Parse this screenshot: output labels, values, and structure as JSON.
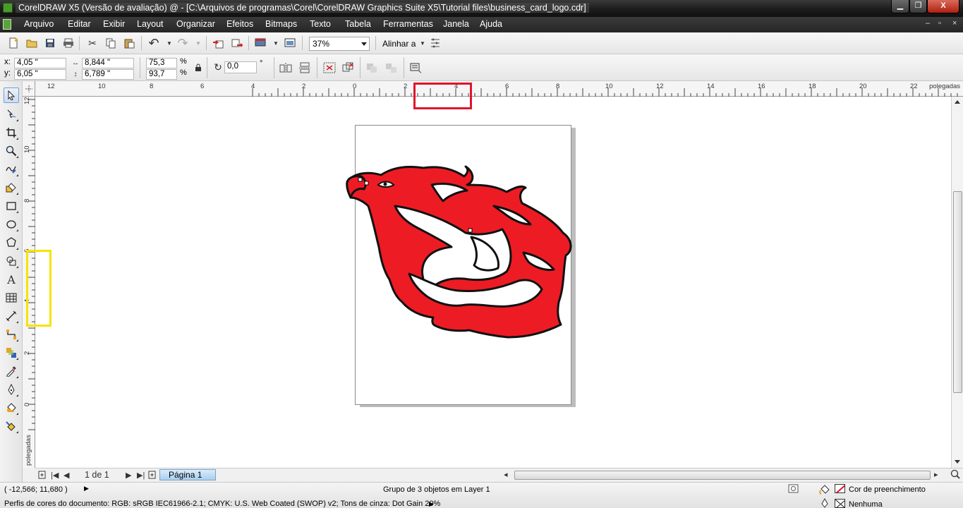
{
  "window": {
    "title": "CorelDRAW X5 (Versão de avaliação) @ - [C:\\Arquivos de programas\\Corel\\CorelDRAW Graphics Suite X5\\Tutorial files\\business_card_logo.cdr]",
    "minimize": "▁",
    "restore": "❐",
    "close": "X"
  },
  "menu": {
    "items": [
      "Arquivo",
      "Editar",
      "Exibir",
      "Layout",
      "Organizar",
      "Efeitos",
      "Bitmaps",
      "Texto",
      "Tabela",
      "Ferramentas",
      "Janela",
      "Ajuda"
    ],
    "mdi_controls": [
      "–",
      "▫",
      "×"
    ]
  },
  "toolbar": {
    "zoom": "37%",
    "align_label": "Alinhar a"
  },
  "property_bar": {
    "x_label": "x:",
    "x_value": "4,05 \"",
    "y_label": "y:",
    "y_value": "6,05 \"",
    "width_value": "8,844 \"",
    "height_value": "6,789 \"",
    "scale_x": "75,3",
    "scale_y": "93,7",
    "percent": "%",
    "rotation": "0,0",
    "degree": "°"
  },
  "rulers": {
    "top_numbers": [
      "12",
      "10",
      "8",
      "6",
      "4",
      "2",
      "0",
      "2",
      "4",
      "6",
      "8",
      "10",
      "12",
      "14",
      "16",
      "18",
      "20",
      "22"
    ],
    "left_numbers": [
      "12",
      "10",
      "8",
      "6",
      "4",
      "2",
      "0"
    ],
    "unit": "polegadas"
  },
  "page_nav": {
    "page_count": "1 de 1",
    "page_tab": "Página 1"
  },
  "status": {
    "coordinates": "( -12,566; 11,680 )",
    "selection": "Grupo de 3 objetos em Layer 1",
    "color_profiles": "Perfis de cores do documento: RGB: sRGB IEC61966-2.1; CMYK: U.S. Web Coated (SWOP) v2; Tons de cinza: Dot Gain 20%",
    "fill_label": "Cor de preenchimento",
    "outline_label": "Nenhuma"
  },
  "colors": {
    "flame_red": "#ed1c24",
    "outline": "#111111",
    "highlight_red": "#e0142c",
    "highlight_yellow": "#f5e400"
  }
}
